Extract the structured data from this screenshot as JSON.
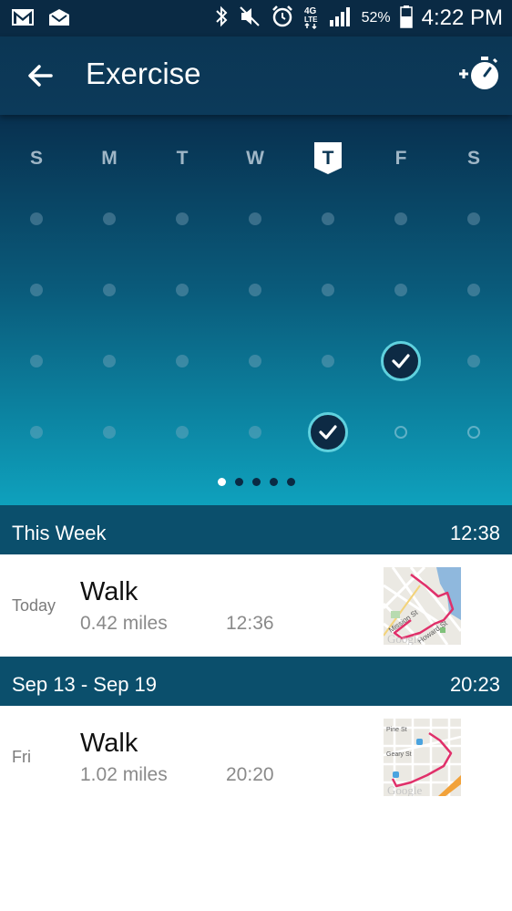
{
  "status_bar": {
    "battery_percent": "52%",
    "time": "4:22 PM",
    "network": "4G LTE",
    "icons": [
      "gmail-icon",
      "inbox-icon",
      "bluetooth-icon",
      "mute-icon",
      "alarm-icon",
      "signal-icon",
      "battery-icon"
    ]
  },
  "header": {
    "title": "Exercise",
    "back_icon": "arrow-left-icon",
    "action_icon": "add-stopwatch-icon"
  },
  "calendar": {
    "weekdays": [
      "S",
      "M",
      "T",
      "W",
      "T",
      "F",
      "S"
    ],
    "today_index": 4,
    "weeks": [
      [
        "empty",
        "empty",
        "empty",
        "empty",
        "empty",
        "empty",
        "empty"
      ],
      [
        "empty",
        "empty",
        "empty",
        "empty",
        "empty",
        "empty",
        "empty"
      ],
      [
        "empty",
        "empty",
        "empty",
        "empty",
        "empty",
        "checked",
        "empty"
      ],
      [
        "empty",
        "empty",
        "empty",
        "empty",
        "checked",
        "future",
        "future"
      ]
    ],
    "pages": 5,
    "active_page": 0
  },
  "sections": [
    {
      "label": "This Week",
      "total": "12:38",
      "items": [
        {
          "day": "Today",
          "name": "Walk",
          "distance": "0.42 miles",
          "duration": "12:36",
          "map_labels": [
            "Mission St",
            "Howard St",
            "Google"
          ]
        }
      ]
    },
    {
      "label": "Sep 13 - Sep 19",
      "total": "20:23",
      "items": [
        {
          "day": "Fri",
          "name": "Walk",
          "distance": "1.02 miles",
          "duration": "20:20",
          "map_labels": [
            "Pine St",
            "Geary St",
            "Google"
          ]
        }
      ]
    }
  ],
  "colors": {
    "app_bar": "#0b3654",
    "accent": "#5fd1de",
    "section_header": "#0b4f6c",
    "route": "#e0306a"
  }
}
